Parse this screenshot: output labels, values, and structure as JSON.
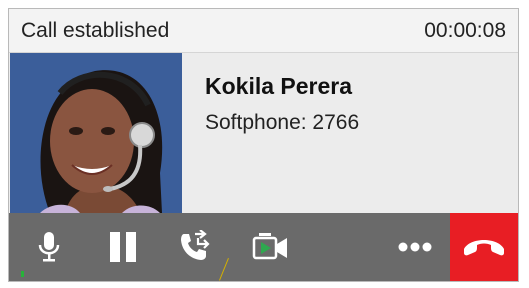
{
  "status": {
    "text": "Call established",
    "timer": "00:00:08"
  },
  "contact": {
    "name": "Kokila Perera",
    "number": "Softphone: 2766"
  },
  "toolbar": {
    "buttons": [
      {
        "icon": "microphone-icon"
      },
      {
        "icon": "pause-icon"
      },
      {
        "icon": "transfer-call-icon"
      },
      {
        "icon": "video-icon"
      },
      {
        "icon": "more-options-icon"
      },
      {
        "icon": "hang-up-icon"
      }
    ]
  },
  "colors": {
    "toolbar": "#6a6a6a",
    "hangup": "#e81e24",
    "video_accent": "#2fa84f",
    "mic_level": "#27b33a"
  }
}
